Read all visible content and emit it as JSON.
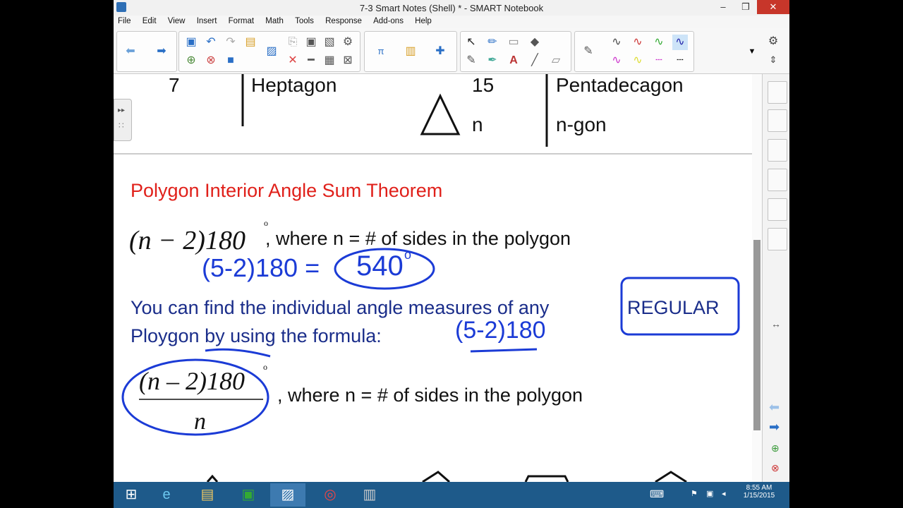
{
  "window": {
    "title": "7-3 Smart Notes (Shell) * - SMART Notebook",
    "min_label": "–",
    "max_label": "❒",
    "close_label": "✕"
  },
  "menu": [
    "File",
    "Edit",
    "View",
    "Insert",
    "Format",
    "Math",
    "Tools",
    "Response",
    "Add-ons",
    "Help"
  ],
  "table": {
    "left_num": "7",
    "left_name": "Heptagon",
    "right_num": "15",
    "right_name": "Pentadecagon",
    "n_label": "n",
    "ngon_label": "n-gon"
  },
  "content": {
    "heading": "Polygon Interior Angle Sum Theorem",
    "formula1": "(n − 2)180",
    "degree": "o",
    "where_text": ", where n = # of sides in the polygon",
    "regular_line_1": "You can find the individual angle measures of any",
    "regular_word": "REGULAR",
    "regular_line_2": "Ploygon by using the formula:",
    "frac_numerator": "(n – 2)180",
    "frac_denominator": "n",
    "where_text_2": ", where n = # of sides in the polygon",
    "ink_1": "(5-2)180 = ",
    "ink_540": "540",
    "ink_deg": "o",
    "ink_2": "(5-2)180"
  },
  "colors": {
    "heading_red": "#e0201a",
    "text_blue": "#1a2d8a",
    "ink_blue": "#1b3bd6"
  },
  "taskbar": {
    "time": "8:55 AM",
    "date": "1/15/2015"
  }
}
